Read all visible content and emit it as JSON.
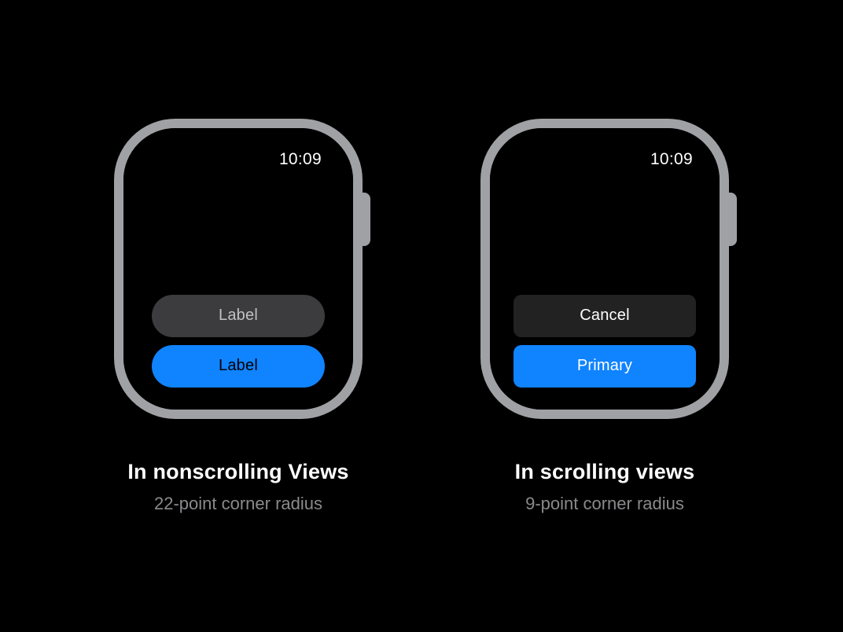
{
  "left": {
    "time": "10:09",
    "buttons": {
      "secondary_label": "Label",
      "primary_label": "Label"
    },
    "caption_title": "In nonscrolling Views",
    "caption_sub": "22-point corner radius"
  },
  "right": {
    "time": "10:09",
    "buttons": {
      "secondary_label": "Cancel",
      "primary_label": "Primary"
    },
    "caption_title": "In scrolling views",
    "caption_sub": "9-point corner radius"
  }
}
